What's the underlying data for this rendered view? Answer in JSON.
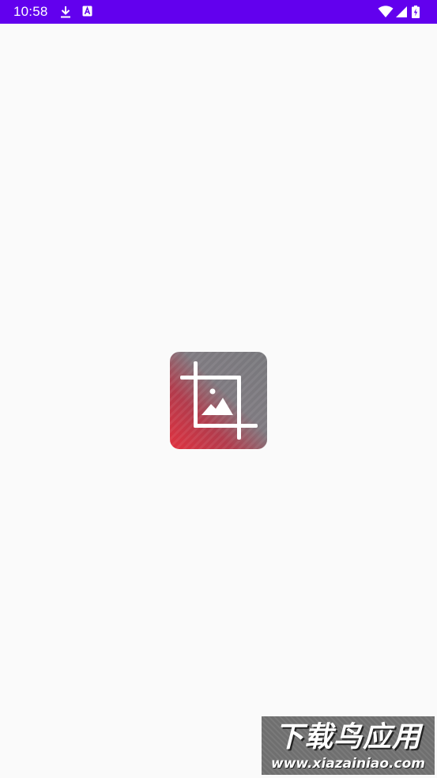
{
  "status_bar": {
    "time": "10:58",
    "background_color": "#6200ee",
    "left_icons": [
      "download-icon",
      "a-notification-icon"
    ],
    "right_icons": [
      "wifi-icon",
      "signal-icon",
      "battery-icon"
    ]
  },
  "splash": {
    "logo_icon": "crop-image-icon",
    "gradient_colors": [
      "#e0313f",
      "#7a7a7e"
    ]
  },
  "watermark": {
    "title": "下载鸟应用",
    "url": "www.xiazainiao.com"
  },
  "colors": {
    "background": "#fafafa",
    "accent": "#6200ee"
  }
}
